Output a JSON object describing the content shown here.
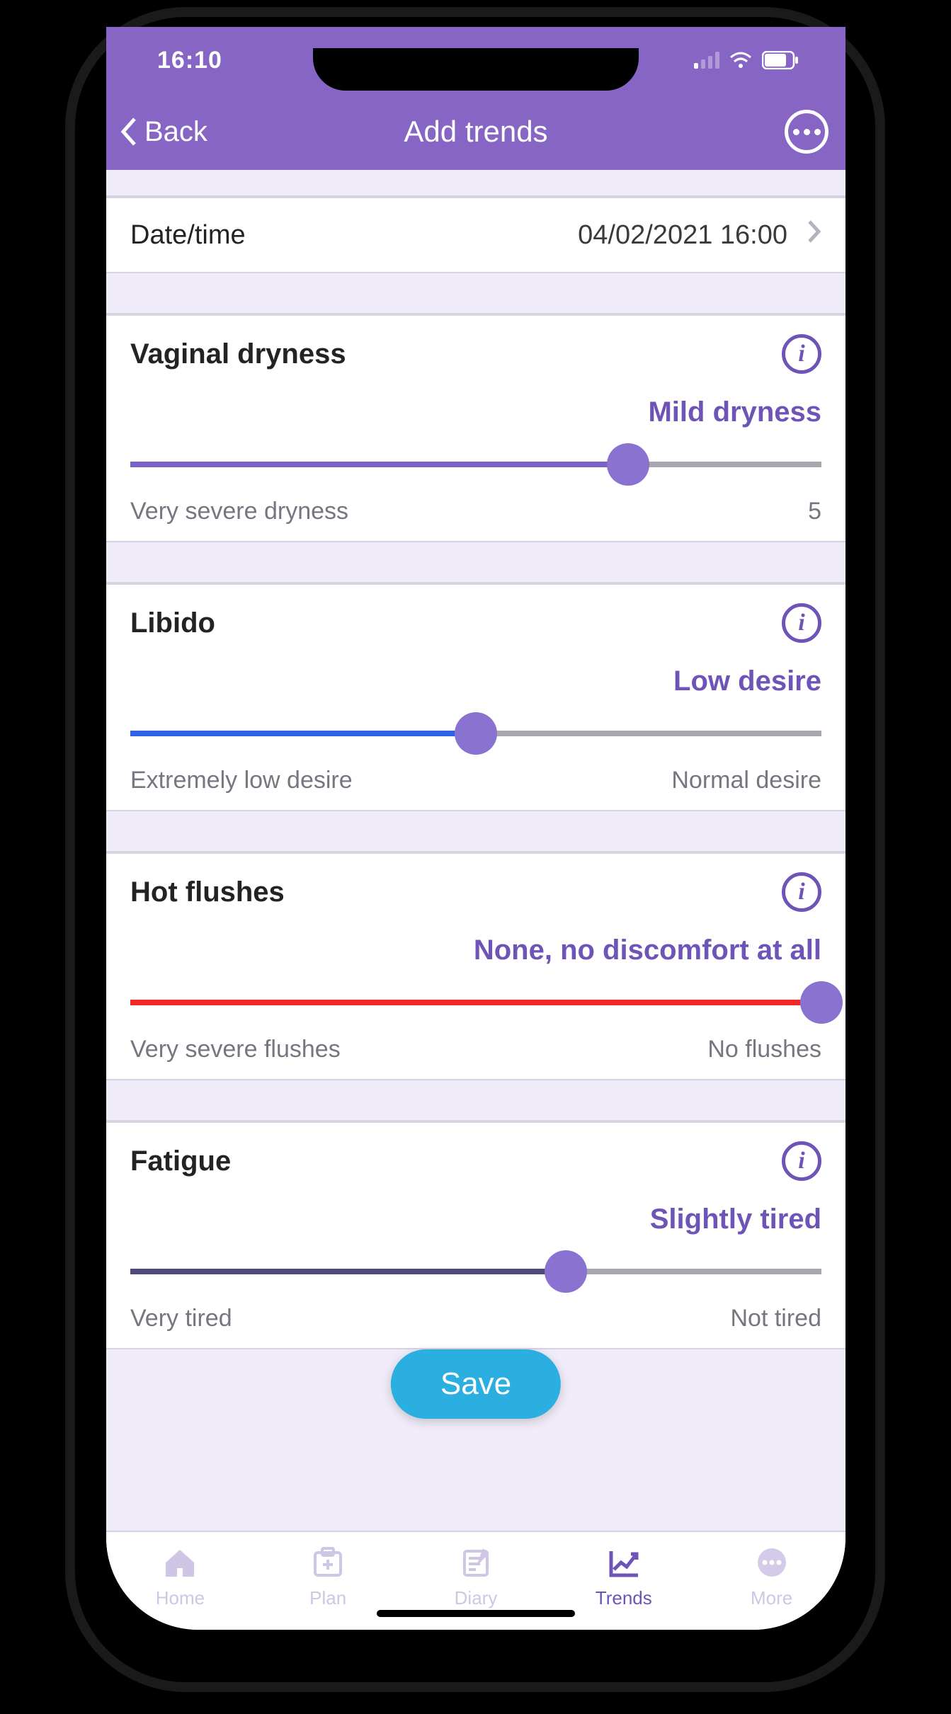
{
  "status": {
    "time": "16:10"
  },
  "nav": {
    "back_label": "Back",
    "title": "Add trends"
  },
  "datetime_row": {
    "label": "Date/time",
    "value": "04/02/2021 16:00"
  },
  "trends": [
    {
      "title": "Vaginal dryness",
      "status": "Mild dryness",
      "fill_color": "#7E63C7",
      "fill_pct": 72,
      "min_label": "Very severe dryness",
      "max_label": "5"
    },
    {
      "title": "Libido",
      "status": "Low desire",
      "fill_color": "#2E63E6",
      "fill_pct": 50,
      "min_label": "Extremely low desire",
      "max_label": "Normal desire"
    },
    {
      "title": "Hot flushes",
      "status": "None, no discomfort at all",
      "fill_color": "#F22828",
      "fill_pct": 100,
      "min_label": "Very severe flushes",
      "max_label": "No flushes"
    },
    {
      "title": "Fatigue",
      "status": "Slightly tired",
      "fill_color": "#4E4A77",
      "fill_pct": 63,
      "min_label": "Very tired",
      "max_label": "Not tired"
    }
  ],
  "save_label": "Save",
  "tabs": [
    {
      "label": "Home",
      "active": false
    },
    {
      "label": "Plan",
      "active": false
    },
    {
      "label": "Diary",
      "active": false
    },
    {
      "label": "Trends",
      "active": true
    },
    {
      "label": "More",
      "active": false
    }
  ]
}
